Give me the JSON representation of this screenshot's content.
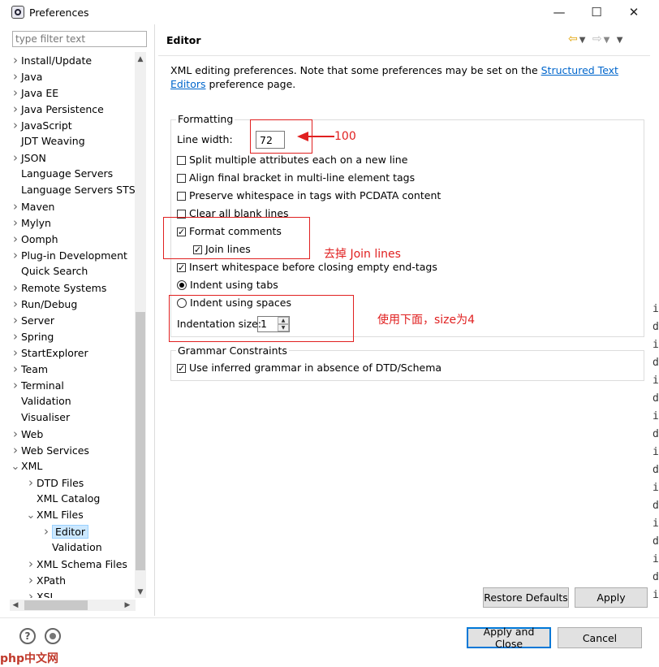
{
  "window": {
    "title": "Preferences",
    "controls": {
      "minimize": "—",
      "maximize": "☐",
      "close": "✕"
    }
  },
  "filter": {
    "placeholder": "type filter text",
    "value": ""
  },
  "tree": {
    "items": [
      {
        "label": "Install/Update",
        "depth": 0,
        "expander": "right"
      },
      {
        "label": "Java",
        "depth": 0,
        "expander": "right"
      },
      {
        "label": "Java EE",
        "depth": 0,
        "expander": "right"
      },
      {
        "label": "Java Persistence",
        "depth": 0,
        "expander": "right"
      },
      {
        "label": "JavaScript",
        "depth": 0,
        "expander": "right"
      },
      {
        "label": "JDT Weaving",
        "depth": 0,
        "expander": "none"
      },
      {
        "label": "JSON",
        "depth": 0,
        "expander": "right"
      },
      {
        "label": "Language Servers",
        "depth": 0,
        "expander": "none"
      },
      {
        "label": "Language Servers STS",
        "depth": 0,
        "expander": "none"
      },
      {
        "label": "Maven",
        "depth": 0,
        "expander": "right"
      },
      {
        "label": "Mylyn",
        "depth": 0,
        "expander": "right"
      },
      {
        "label": "Oomph",
        "depth": 0,
        "expander": "right"
      },
      {
        "label": "Plug-in Development",
        "depth": 0,
        "expander": "right"
      },
      {
        "label": "Quick Search",
        "depth": 0,
        "expander": "none"
      },
      {
        "label": "Remote Systems",
        "depth": 0,
        "expander": "right"
      },
      {
        "label": "Run/Debug",
        "depth": 0,
        "expander": "right"
      },
      {
        "label": "Server",
        "depth": 0,
        "expander": "right"
      },
      {
        "label": "Spring",
        "depth": 0,
        "expander": "right"
      },
      {
        "label": "StartExplorer",
        "depth": 0,
        "expander": "right"
      },
      {
        "label": "Team",
        "depth": 0,
        "expander": "right"
      },
      {
        "label": "Terminal",
        "depth": 0,
        "expander": "right"
      },
      {
        "label": "Validation",
        "depth": 0,
        "expander": "none"
      },
      {
        "label": "Visualiser",
        "depth": 0,
        "expander": "none"
      },
      {
        "label": "Web",
        "depth": 0,
        "expander": "right"
      },
      {
        "label": "Web Services",
        "depth": 0,
        "expander": "right"
      },
      {
        "label": "XML",
        "depth": 0,
        "expander": "down"
      },
      {
        "label": "DTD Files",
        "depth": 1,
        "expander": "right"
      },
      {
        "label": "XML Catalog",
        "depth": 1,
        "expander": "none"
      },
      {
        "label": "XML Files",
        "depth": 1,
        "expander": "down"
      },
      {
        "label": "Editor",
        "depth": 2,
        "expander": "right",
        "selected": true
      },
      {
        "label": "Validation",
        "depth": 2,
        "expander": "none"
      },
      {
        "label": "XML Schema Files",
        "depth": 1,
        "expander": "right"
      },
      {
        "label": "XPath",
        "depth": 1,
        "expander": "right"
      },
      {
        "label": "XSL",
        "depth": 1,
        "expander": "right"
      }
    ]
  },
  "page": {
    "title": "Editor",
    "intro_text": "XML editing preferences.  Note that some preferences may be set on the ",
    "intro_link": "Structured Text Editors",
    "intro_tail": " preference page.",
    "formatting": {
      "group_title": "Formatting",
      "line_width_label": "Line width:",
      "line_width_value": "72",
      "options": [
        {
          "label": "Split multiple attributes each on a new line",
          "checked": false
        },
        {
          "label": "Align final bracket in multi-line element tags",
          "checked": false
        },
        {
          "label": "Preserve whitespace in tags with PCDATA content",
          "checked": false
        },
        {
          "label": "Clear all blank lines",
          "checked": false
        },
        {
          "label": "Format comments",
          "checked": true
        },
        {
          "label": "Join lines",
          "checked": true
        },
        {
          "label": "Insert whitespace before closing empty end-tags",
          "checked": true
        }
      ],
      "indent_tabs_label": "Indent using tabs",
      "indent_spaces_label": "Indent using spaces",
      "indent_selected": "tabs",
      "indentation_size_label": "Indentation size:",
      "indentation_size_value": "1"
    },
    "grammar": {
      "group_title": "Grammar Constraints",
      "option_label": "Use inferred grammar in absence of DTD/Schema",
      "checked": true
    }
  },
  "annotations": {
    "line_width_note": "100",
    "join_lines_note": "去掉 Join lines",
    "indent_note": "使用下面，size为4"
  },
  "buttons": {
    "restore_defaults": "Restore Defaults",
    "apply": "Apply",
    "apply_and_close": "Apply and Close",
    "cancel": "Cancel"
  },
  "footer": {
    "help_icon": "?",
    "badge": "php中文网"
  },
  "edge_strip": [
    "i",
    "d",
    "i",
    "d",
    "i",
    "d",
    "i",
    "d",
    "i",
    "d",
    "i",
    "d",
    "i",
    "d",
    "i",
    "d",
    "i"
  ],
  "colors": {
    "annotation": "#e02020",
    "link": "#0066cc",
    "selection": "#cce8ff",
    "primary_border": "#0078d7"
  }
}
